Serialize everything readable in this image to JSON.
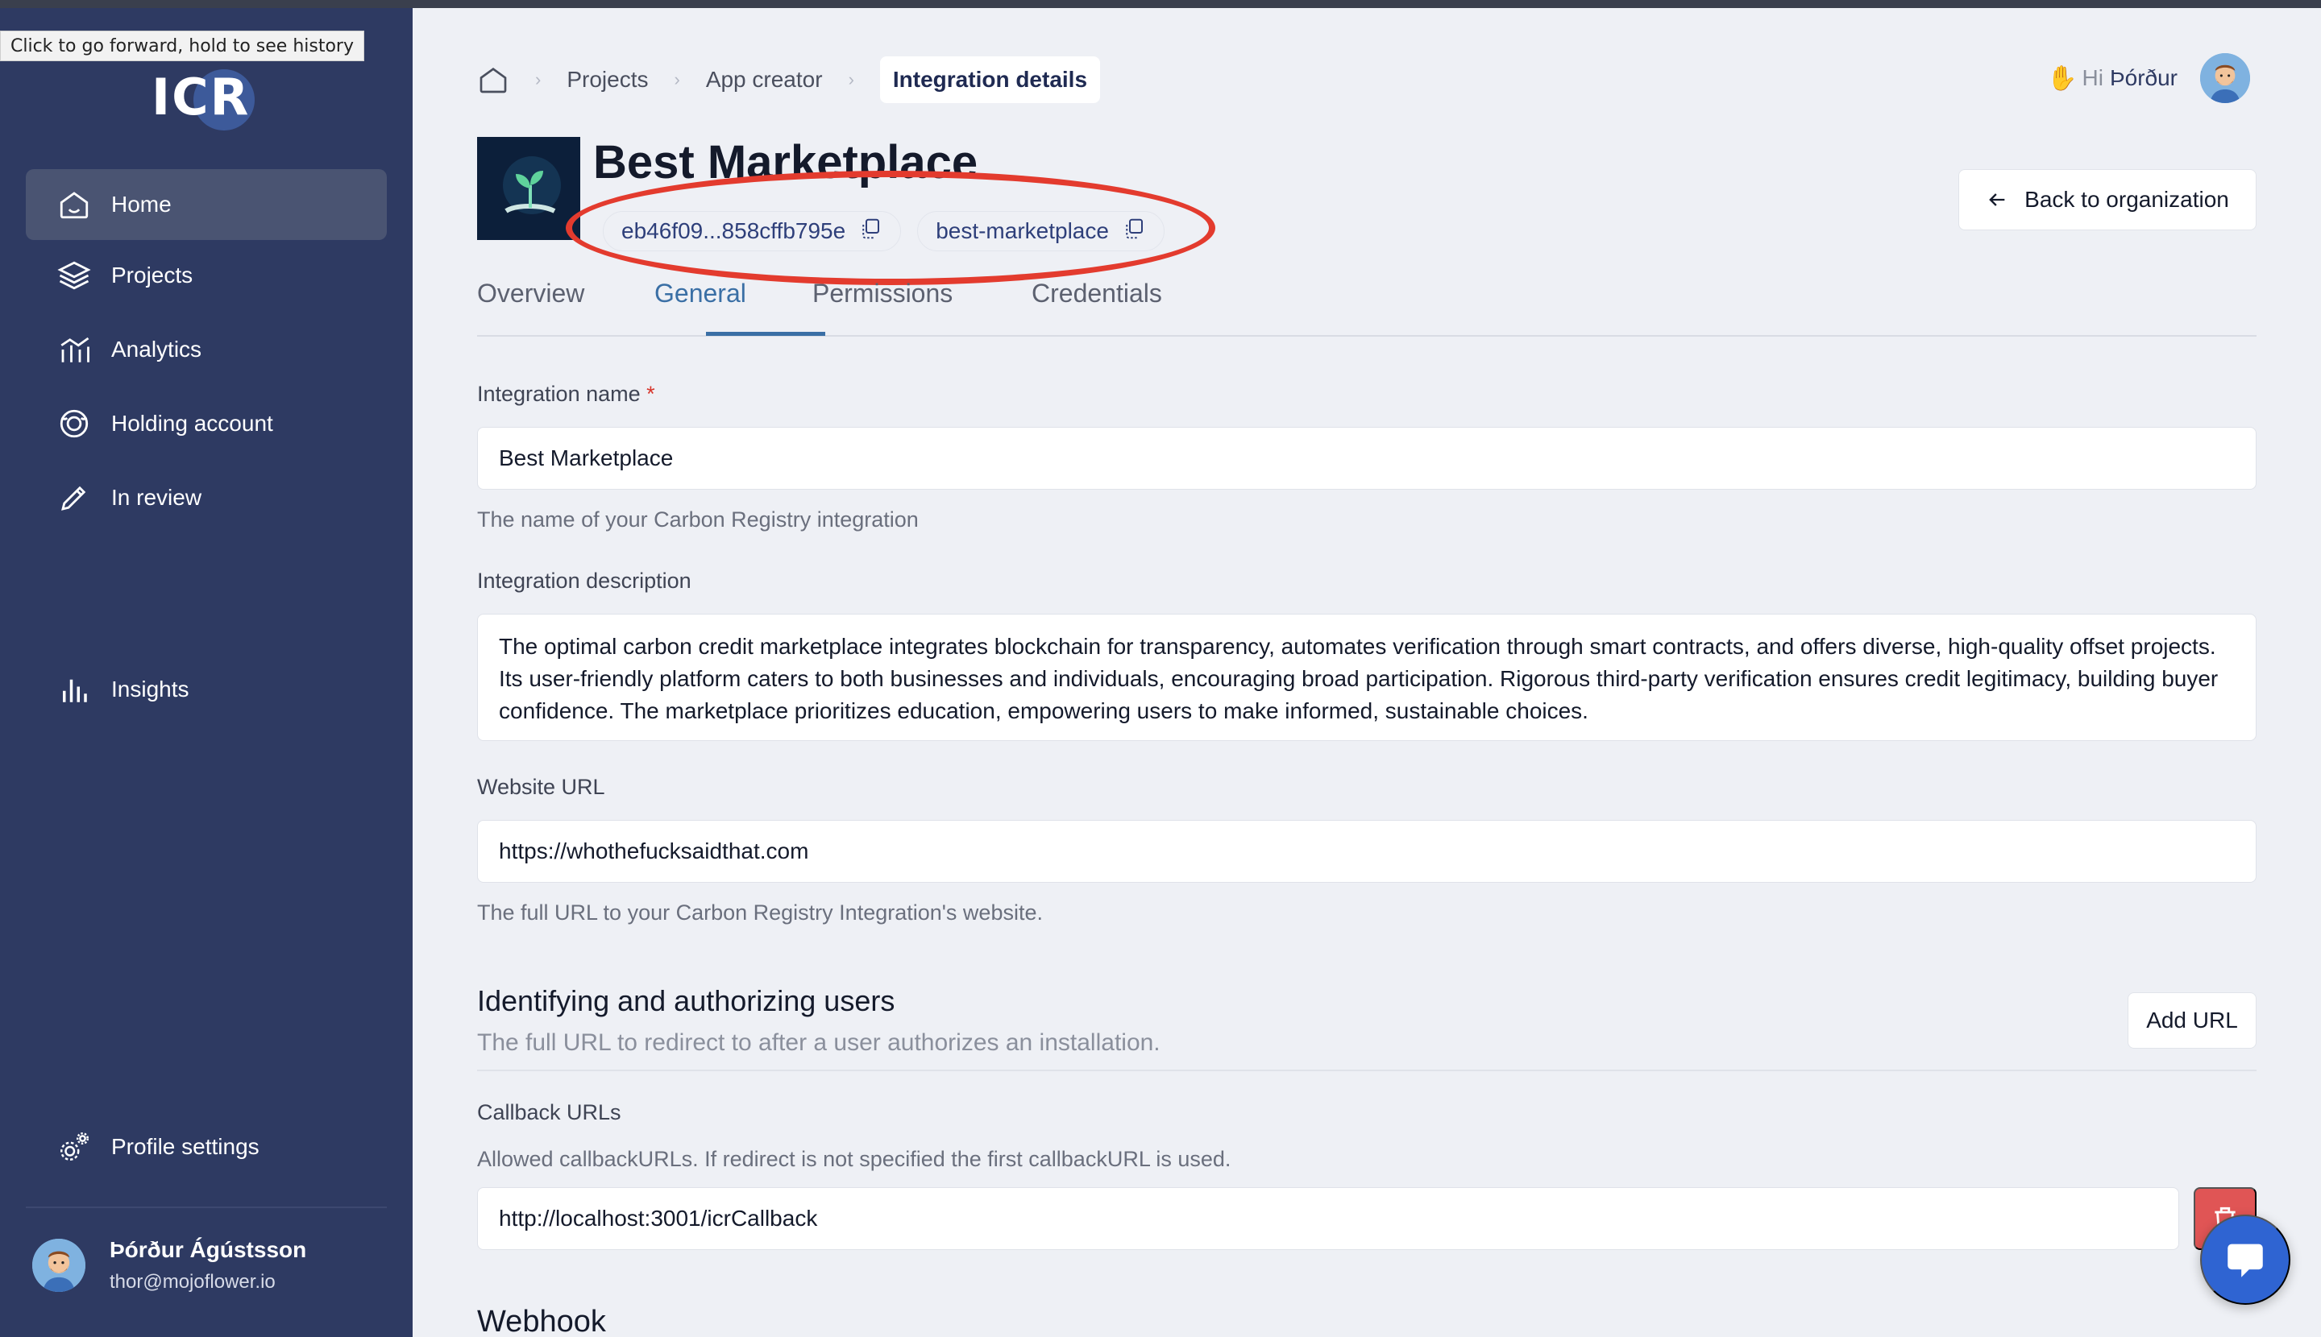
{
  "browser": {
    "tooltip": "Click to go forward, hold to see history"
  },
  "sidebar": {
    "logo": "ICR",
    "items": [
      {
        "label": "Home",
        "icon": "home-icon",
        "active": true
      },
      {
        "label": "Projects",
        "icon": "layers-icon"
      },
      {
        "label": "Analytics",
        "icon": "analytics-icon"
      },
      {
        "label": "Holding account",
        "icon": "holding-icon"
      },
      {
        "label": "In review",
        "icon": "pencil-icon"
      },
      {
        "label": "Insights",
        "icon": "bar-chart-icon"
      },
      {
        "label": "Profile settings",
        "icon": "gears-icon"
      }
    ],
    "user": {
      "name": "Þórður Ágústsson",
      "email": "thor@mojoflower.io"
    }
  },
  "header": {
    "breadcrumbs": [
      "Projects",
      "App creator",
      "Integration details"
    ],
    "greeting_hi": "Hi",
    "greeting_name": "Þórður"
  },
  "integration": {
    "title": "Best Marketplace",
    "id_short": "eb46f09...858cffb795e",
    "slug": "best-marketplace",
    "back_label": "Back to organization"
  },
  "tabs": [
    "Overview",
    "General",
    "Permissions",
    "Credentials"
  ],
  "active_tab": "General",
  "form": {
    "name_label": "Integration name",
    "required_mark": "*",
    "name_value": "Best Marketplace",
    "name_hint": "The name of your Carbon Registry integration",
    "description_label": "Integration description",
    "description_value": "The optimal carbon credit marketplace integrates blockchain for transparency, automates verification through smart contracts, and offers diverse, high-quality offset projects. Its user-friendly platform caters to both businesses and individuals, encouraging broad participation. Rigorous third-party verification ensures credit legitimacy, building buyer confidence. The marketplace prioritizes education, empowering users to make informed, sustainable choices.",
    "website_label": "Website URL",
    "website_value": "https://whothefucksaidthat.com",
    "website_hint": "The full URL to your Carbon Registry Integration's website."
  },
  "auth_section": {
    "title": "Identifying and authorizing users",
    "subtitle": "The full URL to redirect to after a user authorizes an installation.",
    "add_label": "Add URL",
    "callback_label": "Callback URLs",
    "callback_hint": "Allowed callbackURLs. If redirect is not specified the first callbackURL is used.",
    "callback_value": "http://localhost:3001/icrCallback"
  },
  "webhook_title": "Webhook",
  "colors": {
    "sidebar": "#2e3a62",
    "accent": "#3a6fa5",
    "annotation": "#e33b2e",
    "danger": "#e05555",
    "chat": "#2f64d2"
  }
}
